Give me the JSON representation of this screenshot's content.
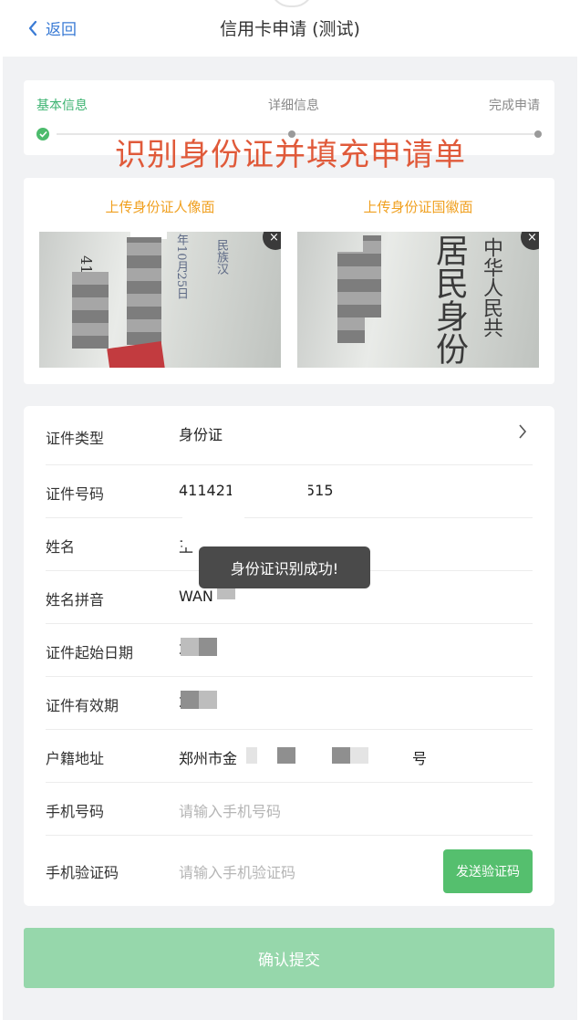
{
  "nav": {
    "back_label": "返回",
    "title": "信用卡申请 (测试)"
  },
  "steps": [
    {
      "label": "基本信息",
      "state": "done"
    },
    {
      "label": "详细信息",
      "state": "pending"
    },
    {
      "label": "完成申请",
      "state": "pending"
    }
  ],
  "overlay_caption": "识别身份证并填充申请单",
  "upload": {
    "front_title": "上传身份证人像面",
    "back_title": "上传身份证国徽面",
    "front_photo_text": [
      "民族汉",
      "年10月25日",
      "41",
      "1"
    ],
    "back_photo_text": [
      "中华人民共",
      "居民身份"
    ],
    "close_glyph": "×"
  },
  "form": {
    "id_type": {
      "label": "证件类型",
      "value": "身份证"
    },
    "id_number": {
      "label": "证件号码",
      "value_start": "411421",
      "value_end": "515"
    },
    "name": {
      "label": "姓名",
      "value": "王"
    },
    "pinyin": {
      "label": "姓名拼音",
      "value": "WAN"
    },
    "start_date": {
      "label": "证件起始日期",
      "value": "2"
    },
    "valid_until": {
      "label": "证件有效期",
      "value": "20"
    },
    "address": {
      "label": "户籍地址",
      "value_start": "郑州市金",
      "value_end": "号"
    },
    "phone": {
      "label": "手机号码",
      "placeholder": "请输入手机号码"
    },
    "sms_code": {
      "label": "手机验证码",
      "placeholder": "请输入手机验证码",
      "button": "发送验证码"
    }
  },
  "toast": "身份证识别成功!",
  "submit_label": "确认提交",
  "colors": {
    "accent_green": "#4cbb6c",
    "link_blue": "#3a7bd5",
    "upload_title": "#f0a020",
    "caption_red": "#e05a3a"
  }
}
